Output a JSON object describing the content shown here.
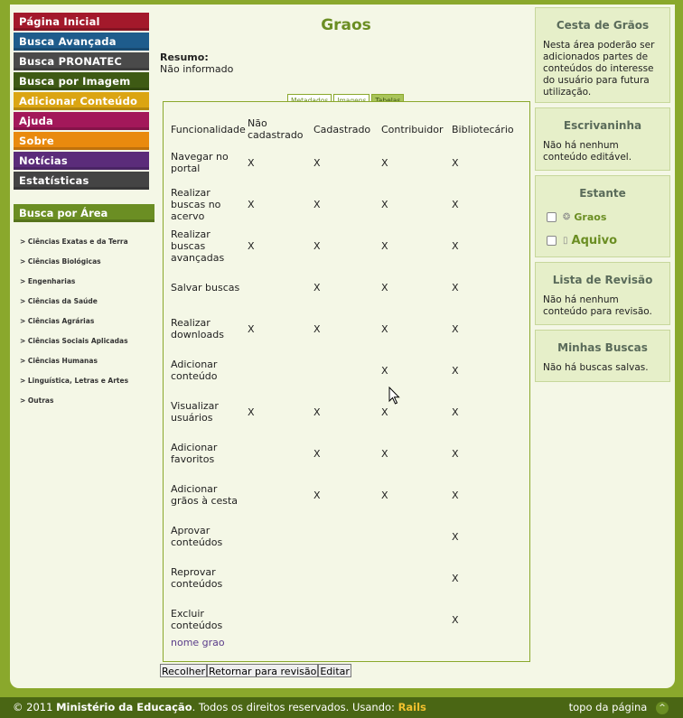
{
  "nav": {
    "items": [
      {
        "label": "Página Inicial",
        "color": "#a3192b"
      },
      {
        "label": "Busca Avançada",
        "color": "#1e5c8c"
      },
      {
        "label": "Busca PRONATEC",
        "color": "#4a4a4a"
      },
      {
        "label": "Busca por Imagem",
        "color": "#3e5a14"
      },
      {
        "label": "Adicionar Conteúdo",
        "color": "#dba512"
      },
      {
        "label": "Ajuda",
        "color": "#a3185a"
      },
      {
        "label": "Sobre",
        "color": "#e98a0e"
      },
      {
        "label": "Notícias",
        "color": "#5b2c7a"
      },
      {
        "label": "Estatísticas",
        "color": "#444444"
      }
    ],
    "area_header": "Busca por Área",
    "areas": [
      "> Ciências Exatas e da Terra",
      "> Ciências Biológicas",
      "> Engenharias",
      "> Ciências da Saúde",
      "> Ciências Agrárias",
      "> Ciências Sociais Aplicadas",
      "> Ciências Humanas",
      "> Linguística, Letras e Artes",
      "> Outras"
    ]
  },
  "main": {
    "title": "Graos",
    "resumo_label": "Resumo:",
    "resumo_value": "Não informado",
    "tabs": [
      "Metadados",
      "Imagens",
      "Tabelas"
    ],
    "active_tab": "Tabelas",
    "table": {
      "headers": [
        "Funcionalidade",
        "Não cadastrado",
        "Cadastrado",
        "Contribuidor",
        "Bibliotecário"
      ],
      "rows": [
        [
          "Navegar no portal",
          "X",
          "X",
          "X",
          "X"
        ],
        [
          "Realizar buscas no acervo",
          "X",
          "X",
          "X",
          "X"
        ],
        [
          "Realizar buscas avançadas",
          "X",
          "X",
          "X",
          "X"
        ],
        [
          "Salvar buscas",
          "",
          "X",
          "X",
          "X"
        ],
        [
          "Realizar downloads",
          "X",
          "X",
          "X",
          "X"
        ],
        [
          "Adicionar conteúdo",
          "",
          "",
          "X",
          "X"
        ],
        [
          "Visualizar usuários",
          "X",
          "X",
          "X",
          "X"
        ],
        [
          "Adicionar favoritos",
          "",
          "X",
          "X",
          "X"
        ],
        [
          "Adicionar grãos à cesta",
          "",
          "X",
          "X",
          "X"
        ],
        [
          "Aprovar conteúdos",
          "",
          "",
          "",
          "X"
        ],
        [
          "Reprovar conteúdos",
          "",
          "",
          "",
          "X"
        ],
        [
          "Excluir conteúdos",
          "",
          "",
          "",
          "X"
        ]
      ]
    },
    "link": "nome grao",
    "buttons": [
      "Recolher",
      "Retornar para revisão",
      "Editar"
    ]
  },
  "sidebar": {
    "cesta": {
      "title": "Cesta de Grãos",
      "text": "Nesta área poderão ser adicionados partes de conteúdos do interesse do usuário para futura utilização."
    },
    "escrivaninha": {
      "title": "Escrivaninha",
      "text": "Não há nenhum conteúdo editável."
    },
    "estante": {
      "title": "Estante",
      "items": [
        "Graos",
        "Aquivo"
      ]
    },
    "revisao": {
      "title": "Lista de Revisão",
      "text": "Não há nenhum conteúdo para revisão."
    },
    "buscas": {
      "title": "Minhas Buscas",
      "text": "Não há buscas salvas."
    }
  },
  "footer": {
    "prefix": "© 2011",
    "org": "Ministério da Educação",
    "rights": ". Todos os direitos reservados. Usando:",
    "rails": "Rails",
    "top_link": "topo da página",
    "up_icon": "^"
  }
}
